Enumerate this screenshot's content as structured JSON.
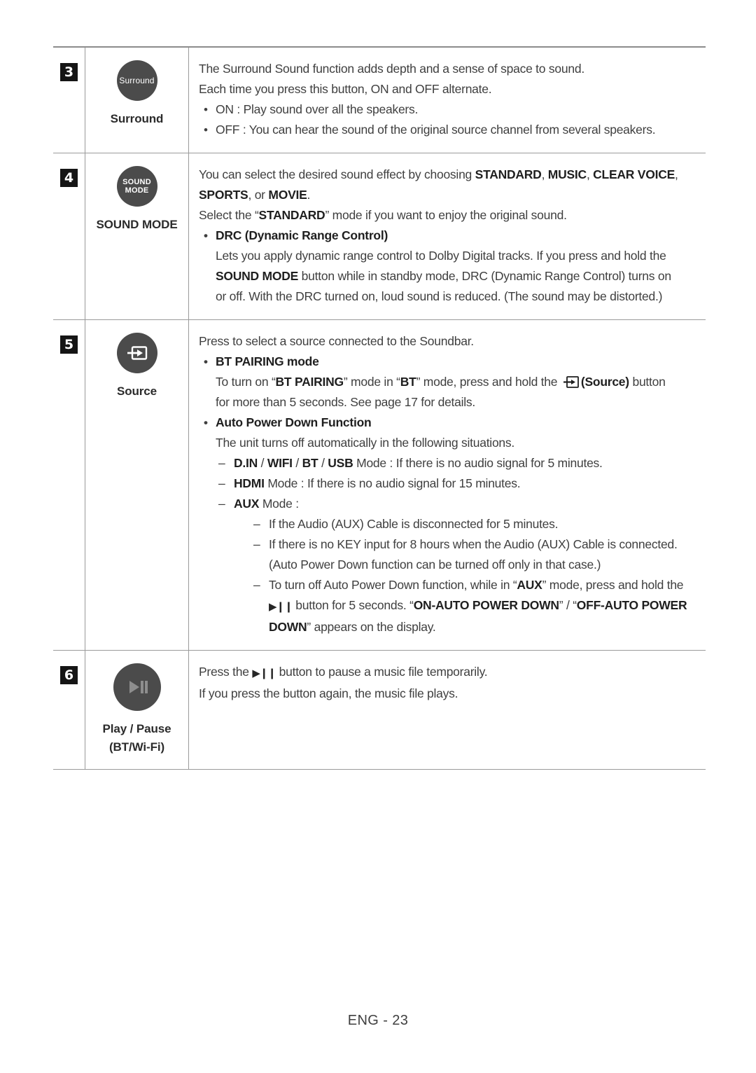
{
  "page": {
    "footer": "ENG - 23"
  },
  "rows": [
    {
      "num": "3",
      "button": {
        "icon": "surround-button-icon",
        "icon_text": "Surround",
        "caption": "Surround"
      },
      "lines": {
        "l1": "The Surround Sound function adds depth and a sense of space to sound.",
        "l2": "Each time you press this button, ON and OFF alternate.",
        "b1": "ON : Play sound over all the speakers.",
        "b2": "OFF : You can hear the sound of the original source channel from several speakers."
      }
    },
    {
      "num": "4",
      "button": {
        "icon": "sound-mode-button-icon",
        "icon_text_line1": "SOUND",
        "icon_text_line2": "MODE",
        "caption": "SOUND MODE"
      },
      "lines": {
        "l1_a": "You can select the desired sound effect by choosing ",
        "l1_b1": "STANDARD",
        "l1_c": ", ",
        "l1_b2": "MUSIC",
        "l1_d": ", ",
        "l1_b3": "CLEAR VOICE",
        "l1_e": ",",
        "l2_b1": "SPORTS",
        "l2_a": ", or ",
        "l2_b2": "MOVIE",
        "l2_b": ".",
        "l3_a": "Select the “",
        "l3_b": "STANDARD",
        "l3_c": "” mode if you want to enjoy the original sound.",
        "drc_title": "DRC (Dynamic Range Control)",
        "drc_p1": "Lets you apply dynamic range control to Dolby Digital tracks. If you press and hold the",
        "drc_p2_b": "SOUND MODE",
        "drc_p2_a": " button while in standby mode, DRC (Dynamic Range Control) turns on",
        "drc_p3": "or off. With the DRC turned on, loud sound is reduced. (The sound may be distorted.)"
      }
    },
    {
      "num": "5",
      "button": {
        "icon": "source-button-icon",
        "caption": "Source"
      },
      "lines": {
        "l1": "Press to select a source connected to the Soundbar.",
        "bt_title": "BT PAIRING mode",
        "bt_p1_a": "To turn on “",
        "bt_p1_b1": "BT PAIRING",
        "bt_p1_c": "” mode in “",
        "bt_p1_b2": "BT",
        "bt_p1_d": "” mode, press and hold the ",
        "bt_p1_b3": "(Source)",
        "bt_p1_e": " button",
        "bt_p2": "for more than 5 seconds. See page 17 for details.",
        "apd_title": "Auto Power Down Function",
        "apd_p1": "The unit turns off automatically in the following situations.",
        "d1_b": "D.IN",
        "d1_s1": " / ",
        "d1_b2": "WIFI",
        "d1_s2": " / ",
        "d1_b3": "BT",
        "d1_s3": " / ",
        "d1_b4": "USB",
        "d1_a": " Mode : If there is no audio signal for 5 minutes.",
        "d2_b": "HDMI",
        "d2_a": " Mode : If there is no audio signal for 15 minutes.",
        "d3_b": "AUX",
        "d3_a": " Mode :",
        "s1": "If the Audio (AUX) Cable is disconnected for 5 minutes.",
        "s2": "If there is no KEY input for 8 hours when the Audio (AUX) Cable is connected.",
        "s2b": "(Auto Power Down function can be turned off only in that case.)",
        "s3_a": "To turn off Auto Power Down function, while in “",
        "s3_b1": "AUX",
        "s3_c": "” mode, press and hold the",
        "s3_d": " button for 5 seconds. “",
        "s3_b2": "ON-AUTO POWER DOWN",
        "s3_e": "” / “",
        "s3_b3": "OFF-AUTO POWER",
        "s3_b4": "DOWN",
        "s3_f": "” appears on the display."
      }
    },
    {
      "num": "6",
      "button": {
        "icon": "play-pause-button-icon",
        "caption_line1": "Play / Pause",
        "caption_line2": "(BT/Wi-Fi)"
      },
      "lines": {
        "l1_a": "Press the",
        "l1_b": " button to pause a music file temporarily.",
        "l2": "If you press the button again, the music file plays."
      }
    }
  ],
  "colors": {
    "button_circle": "#4b4b4b",
    "badge_bg": "#151515",
    "rule": "#9a9a9a",
    "text": "#3f3f3f"
  }
}
